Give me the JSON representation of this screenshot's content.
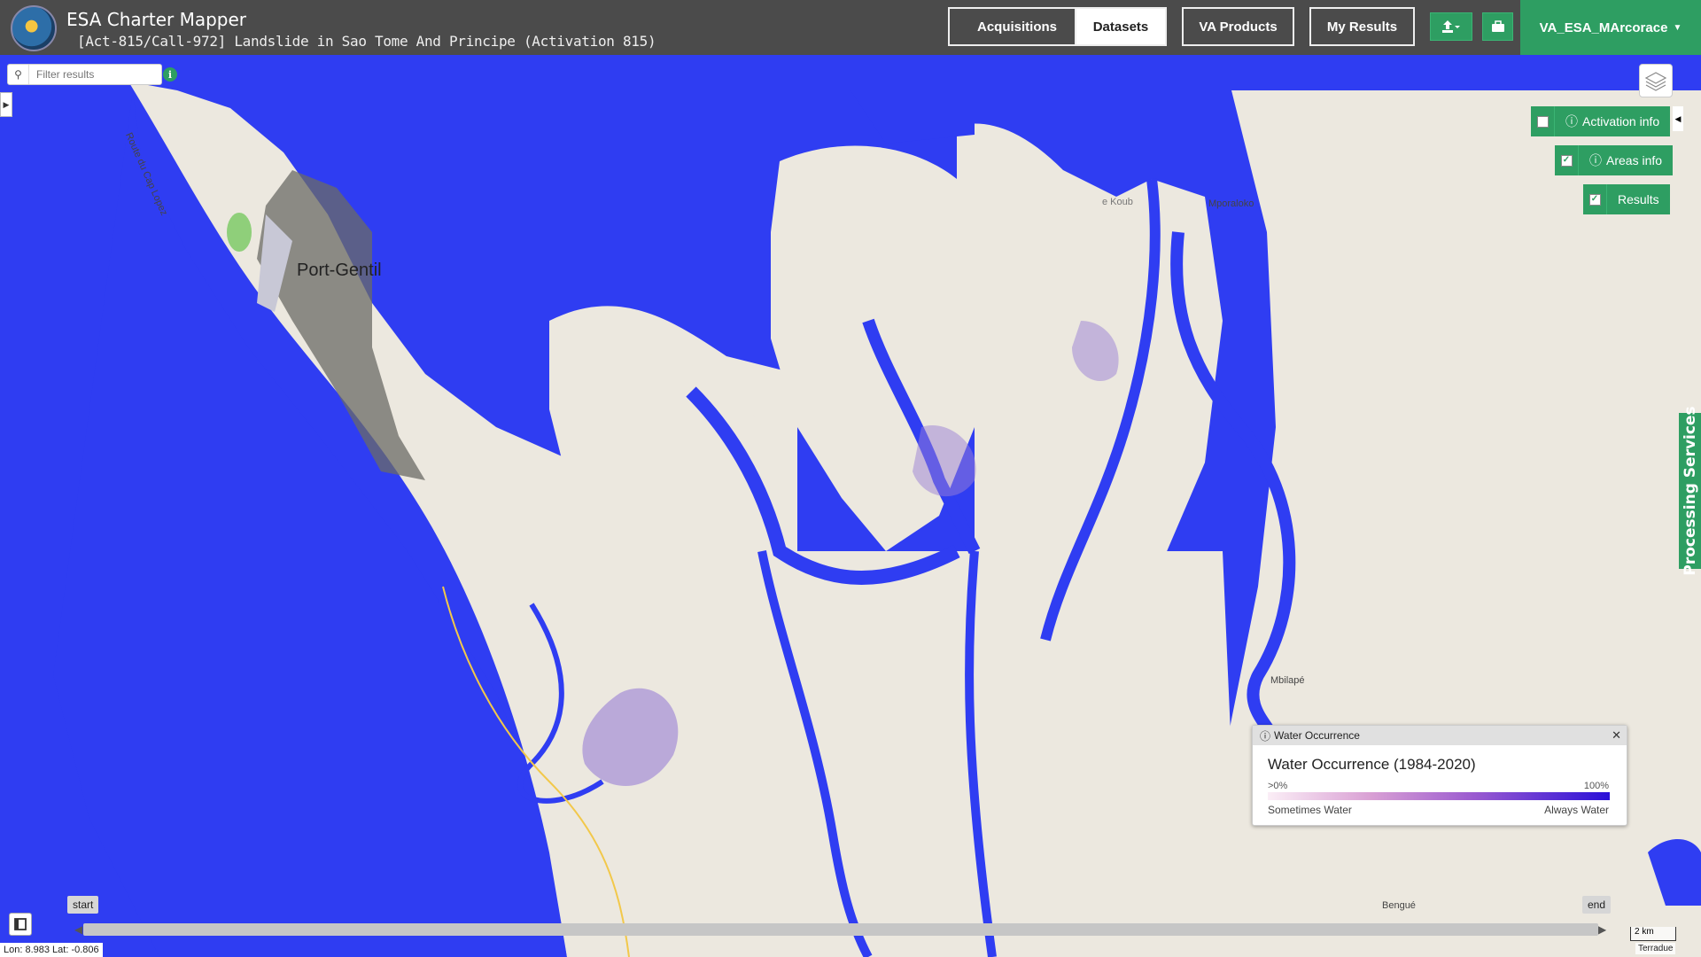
{
  "header": {
    "app_title": "ESA Charter Mapper",
    "activation_title": "[Act-815/Call-972] Landslide in Sao Tome And Principe (Activation 815)",
    "nav": [
      "Acquisitions",
      "Datasets",
      "VA Products",
      "My Results"
    ],
    "active_nav": "Datasets",
    "user": "VA_ESA_MArcorace",
    "icons": [
      "upload-icon",
      "briefcase-icon"
    ]
  },
  "filter": {
    "placeholder": "Filter results"
  },
  "map_controls": {
    "activation_info": "Activation info",
    "areas_info": "Areas info",
    "results": "Results",
    "processing_services": "Processing Services"
  },
  "map_labels": {
    "port_gentil": "Port-Gentil",
    "route": "Route du Cap Lopez",
    "koub": "e Koub",
    "mporaloko": "Mporaloko",
    "mbilape": "Mbilapé",
    "bengue": "Bengué"
  },
  "legend": {
    "header": "Water Occurrence",
    "title": "Water Occurrence (1984-2020)",
    "min": ">0%",
    "max": "100%",
    "low_label": "Sometimes Water",
    "high_label": "Always Water",
    "colors": [
      "#fbeef6",
      "#d9a0d4",
      "#9b5bd0",
      "#2a10d8"
    ]
  },
  "timeline": {
    "start": "start",
    "end": "end"
  },
  "status": {
    "coords": "Lon: 8.983 Lat: -0.806",
    "scale": "2 km",
    "attribution": "Terradue"
  },
  "colors": {
    "water": "#2f3df2",
    "land": "#ece8df",
    "accent": "#2e9e62",
    "header": "#4b4b4b"
  }
}
